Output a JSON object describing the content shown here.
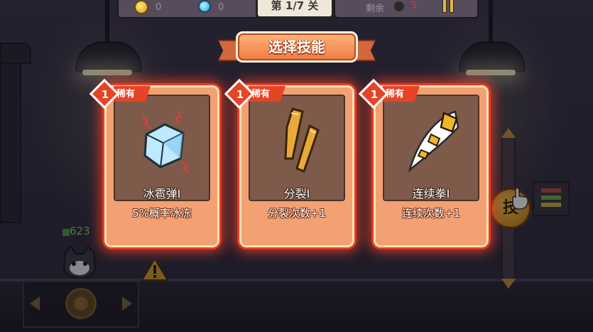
{
  "hud": {
    "coins": "0",
    "gems": "0",
    "level": "第 1/7 关",
    "remaining_label": "剩余",
    "remaining_count": "5",
    "icons": {
      "coin": "coin-icon",
      "gem": "gem-icon",
      "skull": "skull-icon",
      "pause": "pause-icon"
    }
  },
  "dialog": {
    "title": "选择技能",
    "cards": [
      {
        "level": "1",
        "rarity": "稀有",
        "name": "冰雹弹I",
        "desc": "5%概率冰冻",
        "icon": "ice-cube-icon"
      },
      {
        "level": "1",
        "rarity": "稀有",
        "name": "分裂I",
        "desc": "分裂次数+1",
        "icon": "split-bullet-icon"
      },
      {
        "level": "1",
        "rarity": "稀有",
        "name": "连续拳I",
        "desc": "连续次数+1",
        "icon": "fist-icon"
      }
    ]
  },
  "player": {
    "hp": "623"
  },
  "controls": {
    "skill_label": "技"
  },
  "colors": {
    "card_glow": "#e83a23",
    "card_bg": "#f3a173",
    "banner": "#f07a45",
    "rarity": "#e54427"
  }
}
